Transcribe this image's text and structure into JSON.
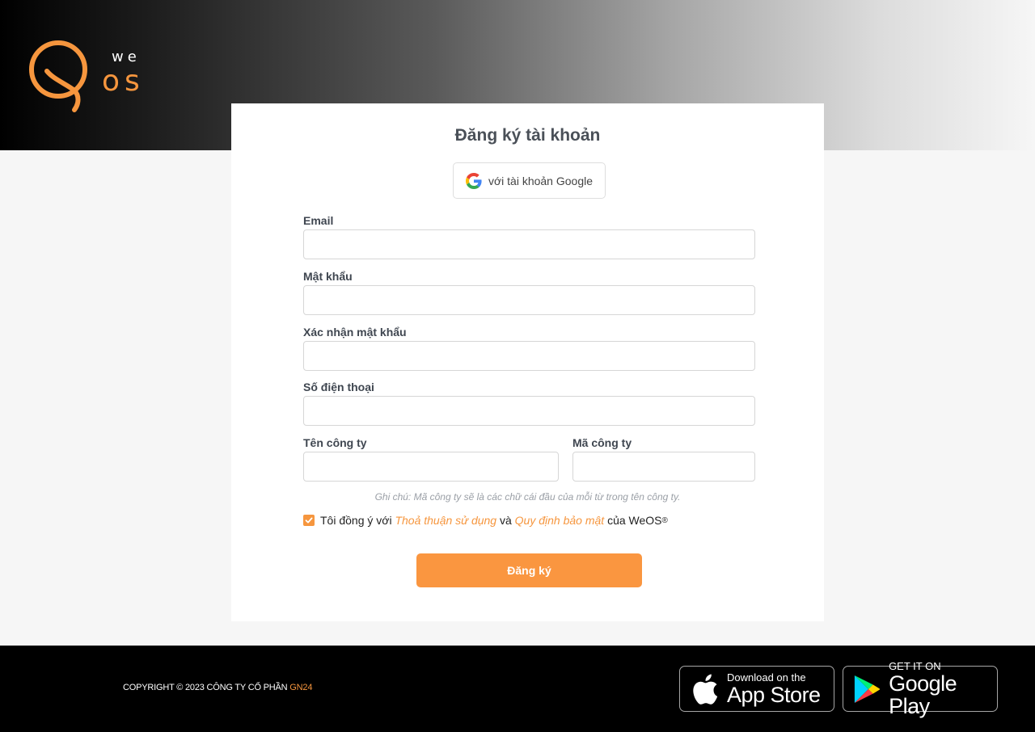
{
  "brand": {
    "logo_we": "we",
    "logo_os": "os",
    "accent": "#f6963e"
  },
  "form": {
    "title": "Đăng ký tài khoản",
    "google_button": "với tài khoản Google",
    "fields": {
      "email": {
        "label": "Email",
        "value": ""
      },
      "password": {
        "label": "Mật khẩu",
        "value": ""
      },
      "confirm_password": {
        "label": "Xác nhận mật khẩu",
        "value": ""
      },
      "phone": {
        "label": "Số điện thoại",
        "value": ""
      },
      "company_name": {
        "label": "Tên công ty",
        "value": ""
      },
      "company_code": {
        "label": "Mã công ty",
        "value": ""
      }
    },
    "note": "Ghi chú: Mã công ty sẽ là các chữ cái đầu của mỗi từ trong tên công ty.",
    "agree": {
      "checked": true,
      "prefix": "Tôi đồng ý với",
      "terms_link": "Thoả thuận sử dụng",
      "and": "và",
      "privacy_link": "Quy định bảo mật",
      "suffix": "của WeOS",
      "registered": "®"
    },
    "submit_label": "Đăng ký"
  },
  "footer": {
    "copyright": "COPYRIGHT © 2023 CÔNG TY CỔ PHẦN",
    "company": "GN24",
    "app_store": {
      "small": "Download on the",
      "big": "App Store"
    },
    "google_play": {
      "small": "GET IT ON",
      "big": "Google Play"
    }
  }
}
